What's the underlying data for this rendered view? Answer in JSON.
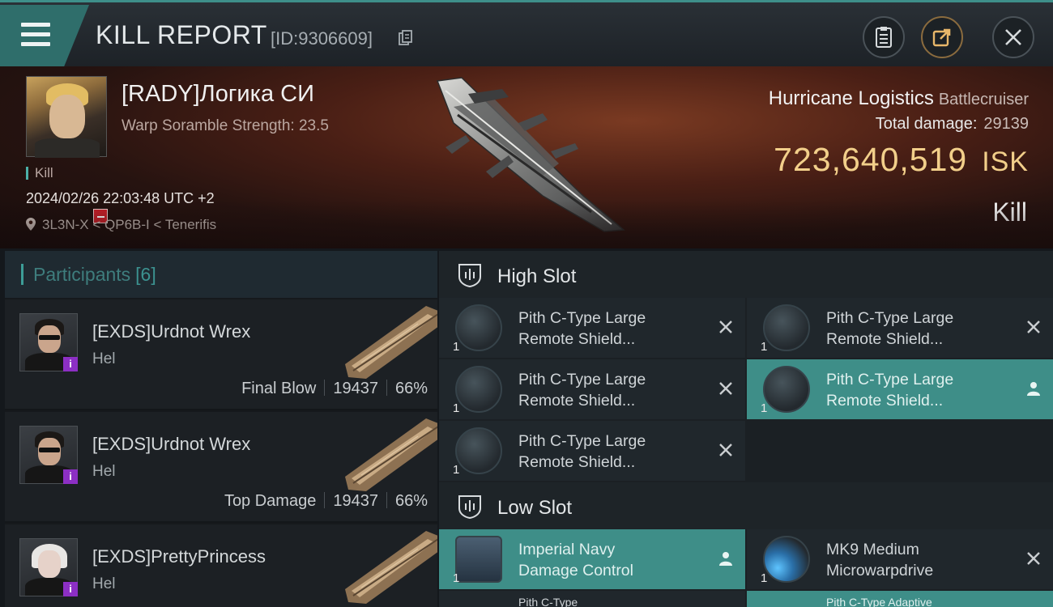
{
  "header": {
    "title": "KILL REPORT",
    "report_id": "[ID:9306609]",
    "icons": [
      "menu-icon",
      "copy-icon",
      "clipboard-icon",
      "share-icon",
      "close-icon"
    ],
    "accent_color": "#3e8f8a"
  },
  "victim": {
    "name": "[RADY]Логика СИ",
    "scramble": "Warp Soramble Strength: 23.5",
    "tag": "Kill",
    "time": "2024/02/26 22:03:48 UTC +2",
    "location": "3L3N-X < QP6B-I < Tenerifis",
    "ship_name": "Hurricane Logistics",
    "ship_class": "Battlecruiser",
    "total_damage_label": "Total damage:",
    "total_damage": "29139",
    "isk_value": "723,640,519",
    "isk_unit": "ISK",
    "result": "Kill"
  },
  "participants": {
    "label": "Participants",
    "count": "[6]",
    "items": [
      {
        "name": "[EXDS]Urdnot Wrex",
        "ship": "Hel",
        "role": "Final Blow",
        "damage": "19437",
        "percent": "66%",
        "badge": "i"
      },
      {
        "name": "[EXDS]Urdnot Wrex",
        "ship": "Hel",
        "role": "Top Damage",
        "damage": "19437",
        "percent": "66%",
        "badge": "i"
      },
      {
        "name": "[EXDS]PrettyPrincess",
        "ship": "Hel",
        "role": "",
        "damage": "",
        "percent": "",
        "badge": "i"
      }
    ]
  },
  "fitting": {
    "high_slot_label": "High Slot",
    "low_slot_label": "Low Slot",
    "high": [
      {
        "line1": "Pith C-Type Large",
        "line2": "Remote Shield...",
        "qty": "1",
        "state": "destroyed"
      },
      {
        "line1": "Pith C-Type Large",
        "line2": "Remote Shield...",
        "qty": "1",
        "state": "destroyed"
      },
      {
        "line1": "Pith C-Type Large",
        "line2": "Remote Shield...",
        "qty": "1",
        "state": "destroyed"
      },
      {
        "line1": "Pith C-Type Large",
        "line2": "Remote Shield...",
        "qty": "1",
        "state": "dropped"
      },
      {
        "line1": "Pith C-Type Large",
        "line2": "Remote Shield...",
        "qty": "1",
        "state": "destroyed"
      }
    ],
    "low": [
      {
        "line1": "Imperial Navy",
        "line2": "Damage Control",
        "qty": "1",
        "state": "dropped"
      },
      {
        "line1": "MK9 Medium",
        "line2": "Microwarpdrive",
        "qty": "1",
        "state": "destroyed"
      },
      {
        "line1": "Pith C-Type",
        "line2": "",
        "qty": "",
        "state": "destroyed"
      },
      {
        "line1": "Pith C-Type Adaptive",
        "line2": "",
        "qty": "",
        "state": "dropped"
      }
    ]
  }
}
